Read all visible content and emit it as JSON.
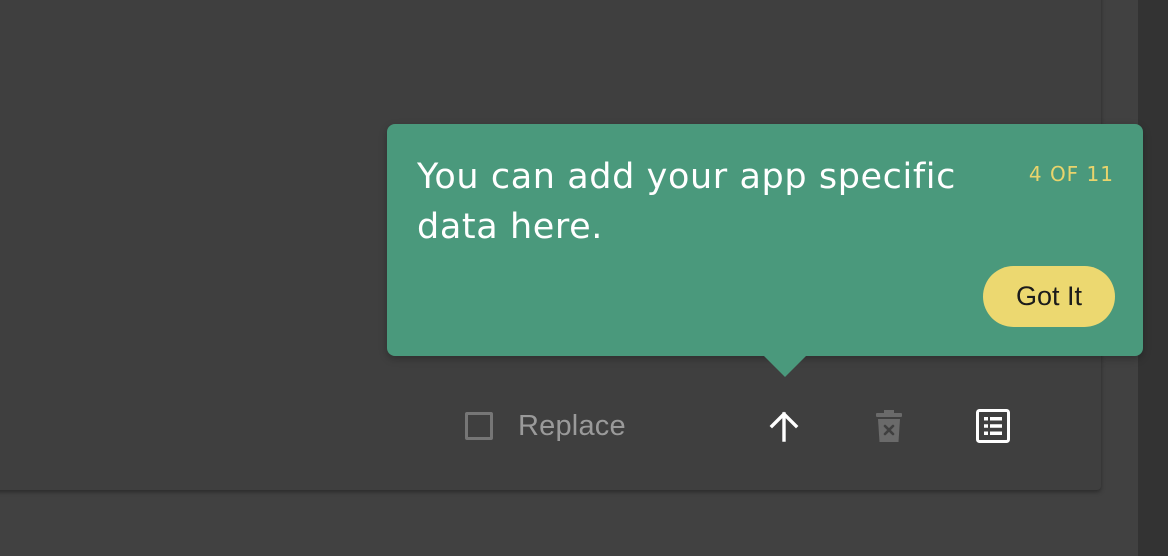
{
  "tour": {
    "message": "You can add your app specific data here.",
    "step_counter": "4 OF 11",
    "got_it_label": "Got It"
  },
  "toolbar": {
    "replace_label": "Replace",
    "replace_checked": false,
    "icons": {
      "upload": "arrow-up-icon",
      "delete": "trash-icon",
      "list": "list-icon"
    }
  },
  "colors": {
    "background": "#414141",
    "tooltip": "#4a997c",
    "accent_yellow": "#ecd870",
    "counter_yellow": "#e9d46c"
  }
}
